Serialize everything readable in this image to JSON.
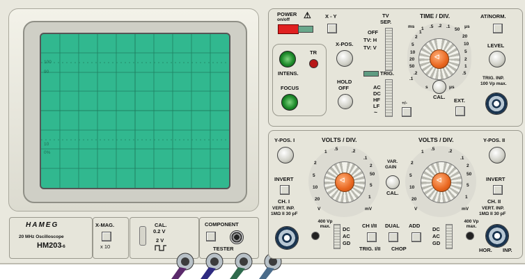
{
  "brand": {
    "logo": "HAMEG",
    "subtitle": "20 MHz Oscilloscope",
    "model": "HM203",
    "model_suffix": "-6"
  },
  "screen": {
    "marks": {
      "top_100": "100",
      "top_90": "90",
      "bottom_10": "10",
      "bottom_0": "0%"
    },
    "phosphor_color": "#31b88f"
  },
  "power": {
    "label": "POWER",
    "sub": "on/off",
    "warning_glyph": "⚠"
  },
  "xy": {
    "label": "X - Y"
  },
  "tv_sep": {
    "label_1": "TV",
    "label_2": "SEP.",
    "off": "OFF",
    "tvh": "TV: H",
    "tvv": "TV: V"
  },
  "trig": {
    "label": "TRIG.",
    "ac": "AC",
    "dc": "DC",
    "hf": "HF",
    "lf": "LF",
    "tilde": "~",
    "plusminus": "+/-",
    "ext": "EXT.",
    "inp": "TRIG. INP.",
    "inp_max": "100 Vp max."
  },
  "time_div": {
    "label": "TIME / DIV.",
    "ms": "ms",
    "us": "μs",
    "s": "s",
    "cal": "CAL.",
    "ticks": [
      "1",
      ".5",
      ".2",
      ".1",
      "50",
      "20",
      "10",
      "5",
      "2",
      "1",
      ".5",
      ".2",
      ".1",
      "20",
      "50",
      "10",
      "5",
      "2",
      "1",
      "2",
      "5",
      "1",
      ".5"
    ]
  },
  "at_norm": {
    "label": "AT/NORM.",
    "level": "LEVEL"
  },
  "intens": {
    "label": "INTENS.",
    "tr": "TR",
    "focus": "FOCUS"
  },
  "xpos": {
    "label": "X-POS.",
    "hold": "HOLD",
    "hold_off": "OFF"
  },
  "ch1": {
    "ypos": "Y-POS. I",
    "volts": "VOLTS / DIV.",
    "invert": "INVERT",
    "ch": "CH. I",
    "vert_inp": "VERT. INP.",
    "imp": "1MΩ II 30 pF",
    "max": "400 Vp max.",
    "dc": "DC",
    "ac": "AC",
    "gd": "GD",
    "ticks": [
      "1",
      ".5",
      ".2",
      ".1",
      "2",
      "5",
      "10",
      "20",
      "50",
      "5",
      "2",
      "1",
      "V",
      "mV"
    ]
  },
  "ch2": {
    "ypos": "Y-POS. II",
    "volts": "VOLTS / DIV.",
    "invert": "INVERT",
    "ch": "CH. II",
    "vert_inp": "VERT. INP.",
    "imp": "1MΩ II 30 pF",
    "max": "400 Vp max.",
    "dc": "DC",
    "ac": "AC",
    "gd": "GD",
    "hor": "HOR.",
    "inp": "INP.",
    "ticks": [
      "1",
      ".5",
      ".2",
      ".1",
      "2",
      "5",
      "10",
      "20",
      "50",
      "5",
      "2",
      "1",
      "V",
      "mV"
    ]
  },
  "var_gain": {
    "var": "VAR.",
    "gain": "GAIN",
    "cal": "CAL."
  },
  "modes": {
    "ch12": "CH I/II",
    "dual": "DUAL",
    "add": "ADD",
    "trig12": "TRIG. I/II",
    "chop": "CHOP"
  },
  "xmag": {
    "label": "X-MAG.",
    "sub": "x 10"
  },
  "cal": {
    "label": "CAL.",
    "v02": "0.2 V",
    "v2": "2 V"
  },
  "component": {
    "label": "COMPONENT",
    "tester": "TESTER"
  }
}
